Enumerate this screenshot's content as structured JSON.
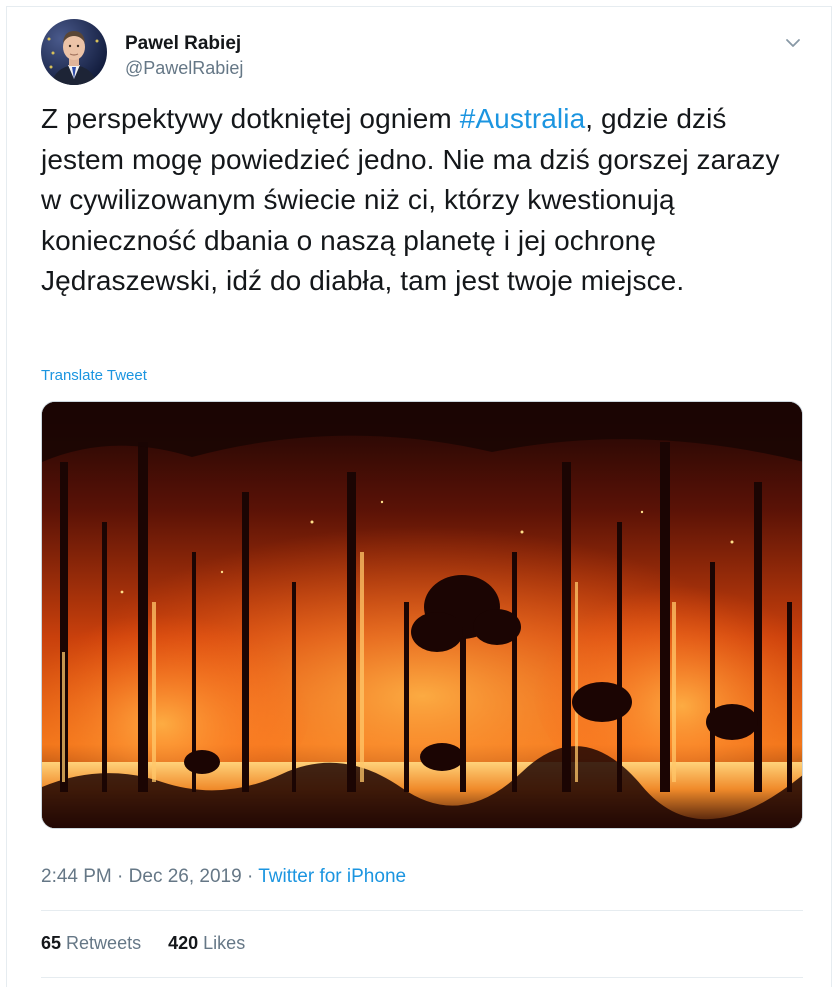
{
  "user": {
    "display_name": "Pawel Rabiej",
    "screen_name": "@PawelRabiej"
  },
  "tweet": {
    "text_before_hashtag": "Z perspektywy dotkniętej ogniem ",
    "hashtag": "#Australia",
    "text_after_hashtag": ", gdzie dziś jestem mogę powiedzieć jedno. Nie ma dziś gorszej zarazy w cywilizowanym świecie niż ci, którzy kwestionują konieczność dbania o naszą planetę i jej ochronę Jędraszewski, idź do diabła, tam jest twoje miejsce.",
    "translate_label": "Translate Tweet"
  },
  "meta": {
    "time": "2:44 PM",
    "separator1": " · ",
    "date": "Dec 26, 2019",
    "separator2": " · ",
    "source": "Twitter for iPhone"
  },
  "stats": {
    "retweets_count": "65",
    "retweets_label": "Retweets",
    "likes_count": "420",
    "likes_label": "Likes"
  },
  "icons": {
    "caret": "chevron-down-icon"
  },
  "colors": {
    "link": "#1b95e0",
    "secondary_text": "#657786",
    "primary_text": "#14171a"
  }
}
